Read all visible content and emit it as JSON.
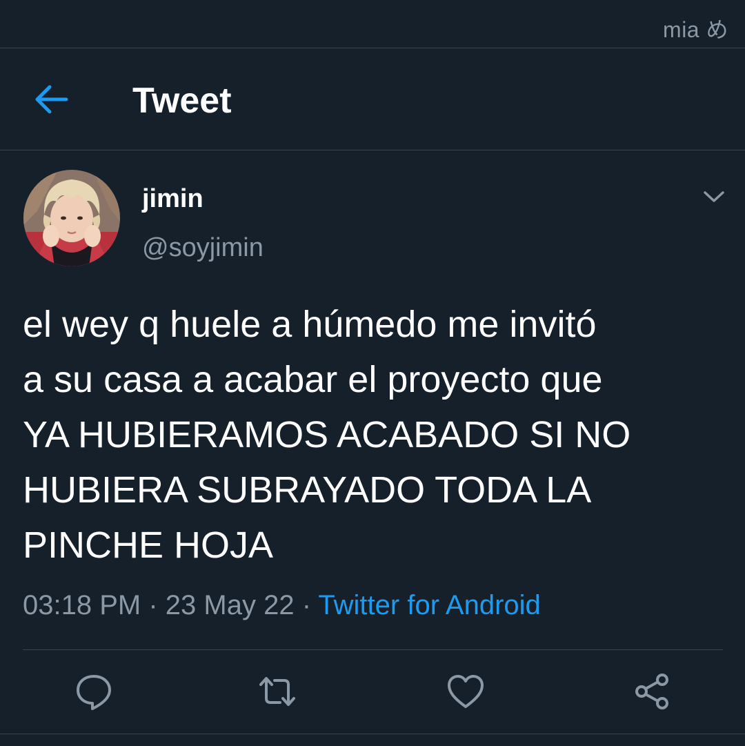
{
  "watermark": "mia め",
  "header": {
    "title": "Tweet"
  },
  "tweet": {
    "author": {
      "name": "jimin",
      "handle": "@soyjimin"
    },
    "text": "el wey q huele a húmedo me invitó\na su casa a acabar el proyecto que\nYA HUBIERAMOS ACABADO SI NO\nHUBIERA SUBRAYADO TODA LA\nPINCHE HOJA",
    "time": "03:18 PM",
    "separator": "·",
    "date": "23 May 22",
    "source": "Twitter for Android"
  },
  "icons": {
    "back": "arrow-left-icon",
    "more": "chevron-down-icon",
    "reply": "reply-icon",
    "retweet": "retweet-icon",
    "like": "heart-icon",
    "share": "share-icon"
  },
  "colors": {
    "background": "#15202b",
    "accent": "#1d9bf0",
    "text": "#ffffff",
    "secondary_text": "#8b98a5",
    "divider": "#38444d"
  }
}
